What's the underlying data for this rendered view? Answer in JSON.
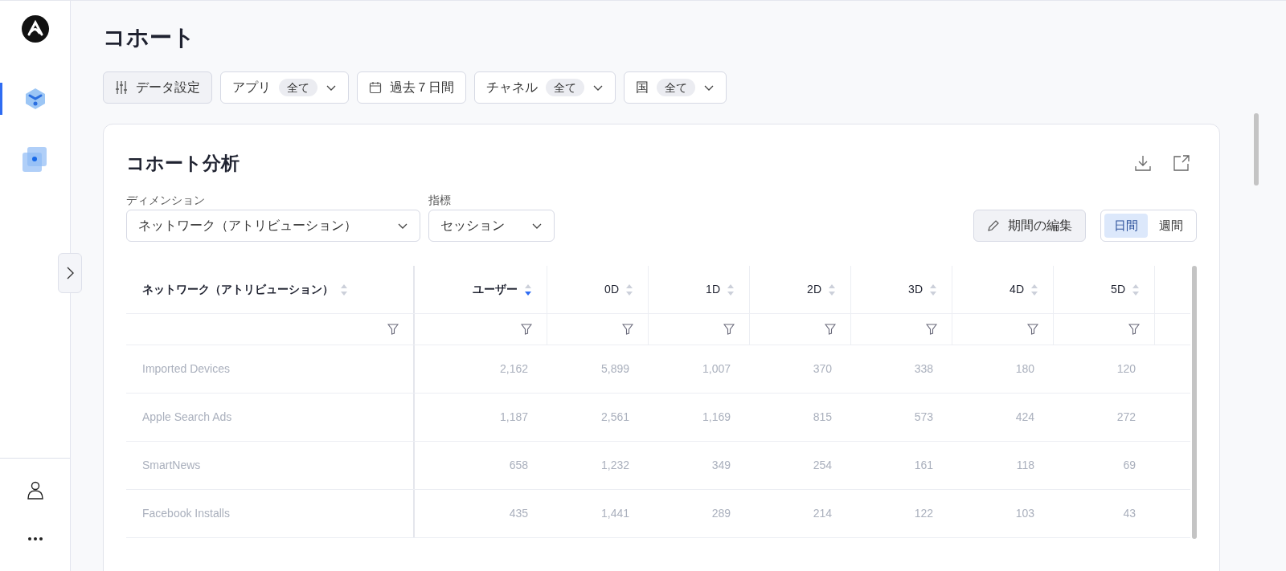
{
  "sidebar": {
    "nav": [
      {
        "kind": "cube",
        "selected": true
      },
      {
        "kind": "squares",
        "selected": false
      }
    ]
  },
  "page_title": "コホート",
  "filters": [
    {
      "kind": "settings",
      "label": "データ設定"
    },
    {
      "kind": "dropdown",
      "label": "アプリ",
      "badge": "全て"
    },
    {
      "kind": "date",
      "label": "過去７日間"
    },
    {
      "kind": "dropdown",
      "label": "チャネル",
      "badge": "全て"
    },
    {
      "kind": "dropdown",
      "label": "国",
      "badge": "全て"
    }
  ],
  "card": {
    "title": "コホート分析",
    "dimension": {
      "label": "ディメンション",
      "value": "ネットワーク（アトリビューション）"
    },
    "metric": {
      "label": "指標",
      "value": "セッション"
    },
    "edit_button": "期間の編集",
    "period_tabs": [
      {
        "label": "日間",
        "selected": true
      },
      {
        "label": "週間",
        "selected": false
      }
    ],
    "table": {
      "columns": [
        {
          "label": "ネットワーク（アトリビューション）",
          "sorted_desc": false
        },
        {
          "label": "ユーザー",
          "sorted_desc": true
        },
        {
          "label": "0D",
          "sorted_desc": false
        },
        {
          "label": "1D",
          "sorted_desc": false
        },
        {
          "label": "2D",
          "sorted_desc": false
        },
        {
          "label": "3D",
          "sorted_desc": false
        },
        {
          "label": "4D",
          "sorted_desc": false
        },
        {
          "label": "5D",
          "sorted_desc": false
        }
      ],
      "rows": [
        {
          "cells": [
            "Imported Devices",
            "2,162",
            "5,899",
            "1,007",
            "370",
            "338",
            "180",
            "120"
          ]
        },
        {
          "cells": [
            "Apple Search Ads",
            "1,187",
            "2,561",
            "1,169",
            "815",
            "573",
            "424",
            "272"
          ]
        },
        {
          "cells": [
            "SmartNews",
            "658",
            "1,232",
            "349",
            "254",
            "161",
            "118",
            "69"
          ]
        },
        {
          "cells": [
            "Facebook Installs",
            "435",
            "1,441",
            "289",
            "214",
            "122",
            "103",
            "43"
          ]
        }
      ]
    }
  }
}
